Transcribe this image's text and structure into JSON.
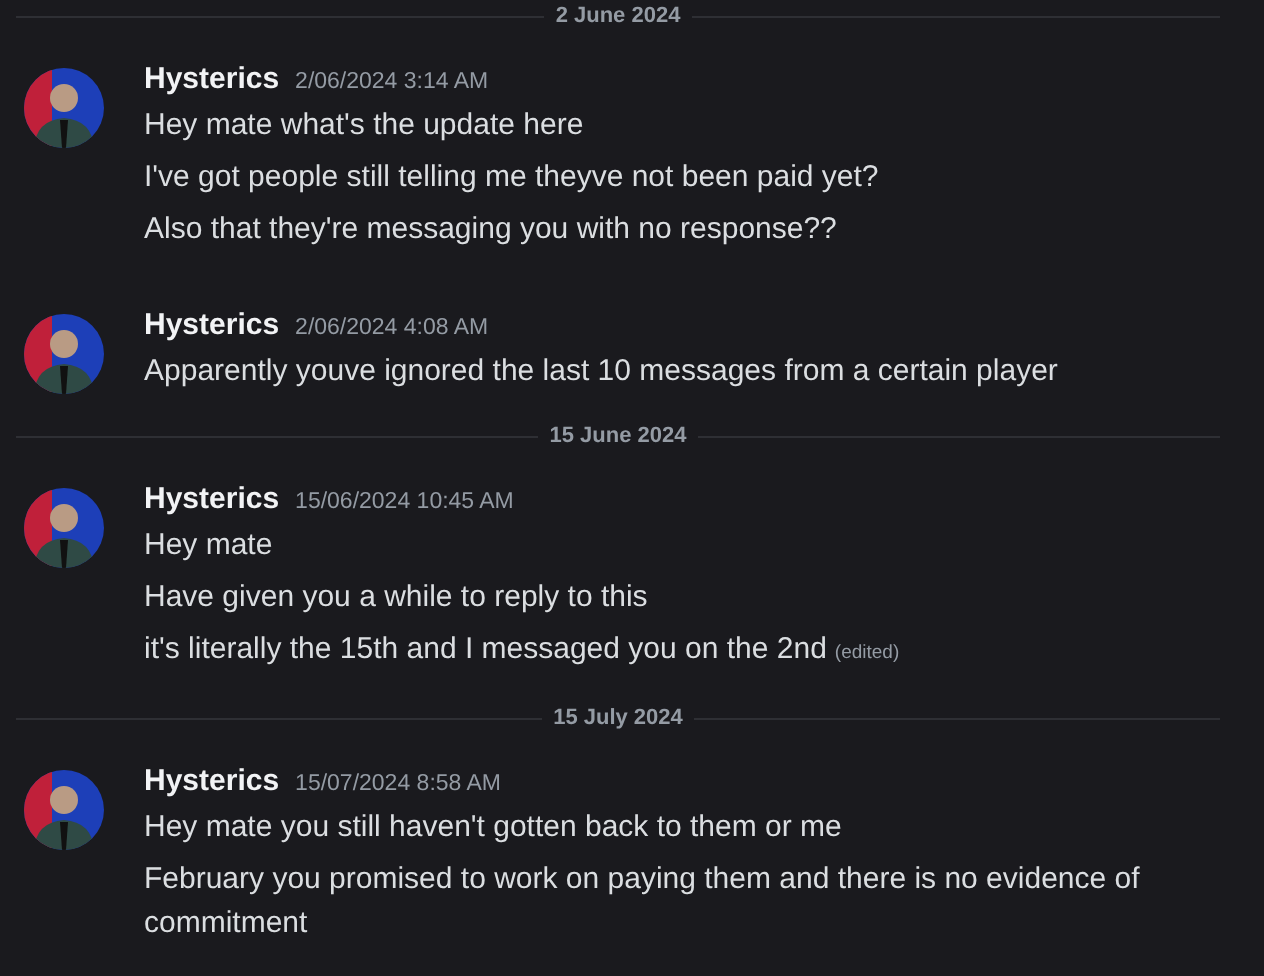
{
  "feed": [
    {
      "kind": "divider",
      "label": "2 June 2024"
    },
    {
      "kind": "message",
      "author": "Hysterics",
      "timestamp": "2/06/2024 3:14 AM",
      "lines": [
        {
          "text": "Hey mate what's the update here"
        },
        {
          "text": "I've got people still telling me theyve not been paid yet?"
        },
        {
          "text": "Also that they're messaging you with no response??"
        }
      ]
    },
    {
      "kind": "message",
      "author": "Hysterics",
      "timestamp": "2/06/2024 4:08 AM",
      "lines": [
        {
          "text": "Apparently youve ignored the last 10 messages from a certain player"
        }
      ]
    },
    {
      "kind": "divider",
      "label": "15 June 2024"
    },
    {
      "kind": "message",
      "author": "Hysterics",
      "timestamp": "15/06/2024 10:45 AM",
      "lines": [
        {
          "text": "Hey mate"
        },
        {
          "text": "Have given you a while to reply to this"
        },
        {
          "text": "it's literally the 15th and I messaged you on the 2nd",
          "edited": "(edited)"
        }
      ]
    },
    {
      "kind": "divider",
      "label": "15 July 2024"
    },
    {
      "kind": "message",
      "author": "Hysterics",
      "timestamp": "15/07/2024 8:58 AM",
      "lines": [
        {
          "text": "Hey mate you still haven't gotten back to them or me"
        },
        {
          "text": "February you promised to work on paying them and there is no evidence of commitment"
        }
      ]
    }
  ]
}
